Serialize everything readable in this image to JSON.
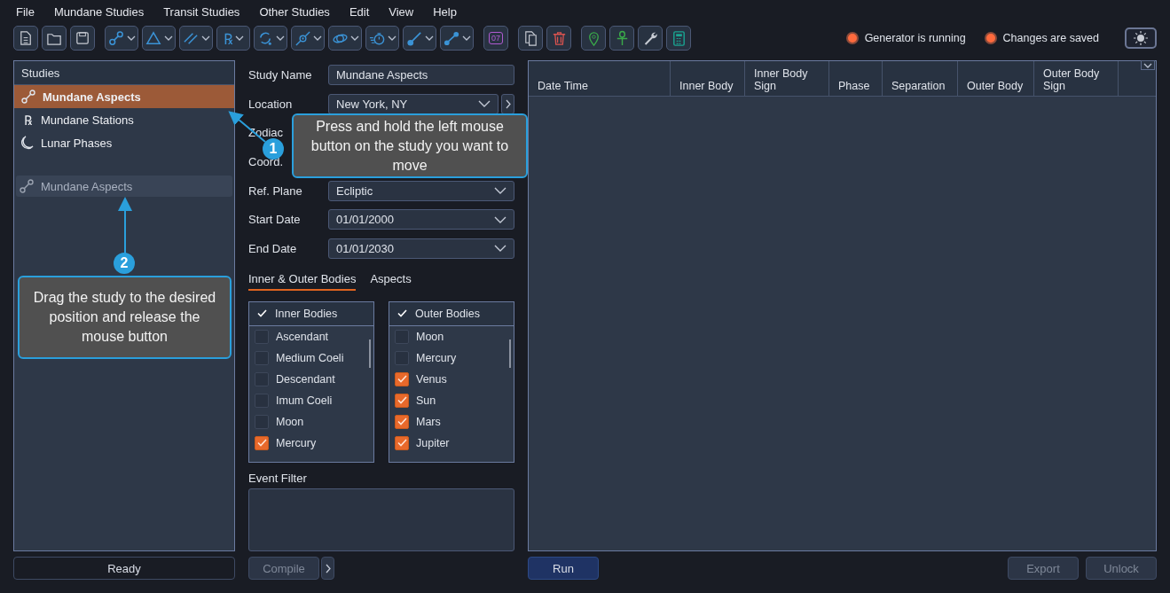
{
  "menu": [
    {
      "label": "File"
    },
    {
      "label": "Mundane Studies"
    },
    {
      "label": "Transit Studies"
    },
    {
      "label": "Other Studies"
    },
    {
      "label": "Edit"
    },
    {
      "label": "View"
    },
    {
      "label": "Help"
    }
  ],
  "toolbar": [
    {
      "tools": [
        {
          "kind": "button"
        },
        {
          "kind": "button"
        },
        {
          "kind": "button"
        }
      ]
    },
    {
      "tools": [
        {
          "kind": "dropdown"
        },
        {
          "kind": "dropdown"
        },
        {
          "kind": "dropdown"
        },
        {
          "kind": "dropdown",
          "glyph": "℞"
        },
        {
          "kind": "dropdown"
        },
        {
          "kind": "dropdown"
        },
        {
          "kind": "dropdown"
        },
        {
          "kind": "dropdown"
        },
        {
          "kind": "dropdown"
        },
        {
          "kind": "dropdown"
        }
      ]
    },
    {
      "tools": [
        {
          "kind": "date",
          "glyph": "07"
        }
      ]
    },
    {
      "tools": [
        {
          "kind": "button"
        },
        {
          "kind": "button"
        }
      ]
    },
    {
      "tools": [
        {
          "kind": "button"
        },
        {
          "kind": "button"
        },
        {
          "kind": "button"
        },
        {
          "kind": "button"
        }
      ]
    }
  ],
  "indicators": [
    {
      "label": "Generator is running",
      "on": true
    },
    {
      "label": "Changes are saved",
      "on": true
    }
  ],
  "studies": {
    "title": "Studies",
    "items": [
      {
        "label": "Mundane Aspects",
        "kind": "aspect",
        "selected": true
      },
      {
        "label": "Mundane Stations",
        "kind": "station",
        "glyph": "℞",
        "selected": false
      },
      {
        "label": "Lunar Phases",
        "kind": "phase",
        "selected": false
      }
    ],
    "drag_ghost": {
      "label": "Mundane Aspects",
      "kind": "aspect"
    }
  },
  "status": "Ready",
  "form": [
    {
      "label": "Study Name",
      "kind": "text",
      "value": "Mundane Aspects"
    },
    {
      "label": "Location",
      "kind": "select_more",
      "value": "New York, NY"
    },
    {
      "label": "Zodiac",
      "kind": "hidden"
    },
    {
      "label": "Coord.",
      "kind": "hidden"
    },
    {
      "label": "Ref. Plane",
      "kind": "select",
      "value": "Ecliptic"
    },
    {
      "label": "Start Date",
      "kind": "select",
      "value": "01/01/2000"
    },
    {
      "label": "End Date",
      "kind": "select",
      "value": "01/01/2030"
    }
  ],
  "tabs": [
    {
      "label": "Inner & Outer Bodies",
      "selected": true
    },
    {
      "label": "Aspects",
      "selected": false
    }
  ],
  "lists": [
    {
      "title": "Inner Bodies",
      "checked": true,
      "items": [
        {
          "label": "Ascendant",
          "checked": false
        },
        {
          "label": "Medium Coeli",
          "checked": false
        },
        {
          "label": "Descendant",
          "checked": false
        },
        {
          "label": "Imum Coeli",
          "checked": false
        },
        {
          "label": "Moon",
          "checked": false
        },
        {
          "label": "Mercury",
          "checked": true
        }
      ]
    },
    {
      "title": "Outer Bodies",
      "checked": true,
      "items": [
        {
          "label": "Moon",
          "checked": false
        },
        {
          "label": "Mercury",
          "checked": false
        },
        {
          "label": "Venus",
          "checked": true
        },
        {
          "label": "Sun",
          "checked": true
        },
        {
          "label": "Mars",
          "checked": true
        },
        {
          "label": "Jupiter",
          "checked": true
        }
      ]
    }
  ],
  "event_filter": {
    "label": "Event Filter"
  },
  "compile": {
    "label": "Compile",
    "disabled": true
  },
  "table": {
    "columns": [
      {
        "label": "Date Time"
      },
      {
        "label": "Inner Body"
      },
      {
        "label": "Inner Body Sign"
      },
      {
        "label": "Phase"
      },
      {
        "label": "Separation"
      },
      {
        "label": "Outer Body"
      },
      {
        "label": "Outer Body Sign"
      }
    ]
  },
  "actions": [
    {
      "label": "Run",
      "disabled": false
    },
    {
      "label": "Export",
      "disabled": true
    },
    {
      "label": "Unlock",
      "disabled": true
    }
  ],
  "callouts": [
    {
      "number": "1",
      "text": "Press and hold the left mouse button on the study you want to move"
    },
    {
      "number": "2",
      "text": "Drag the study to the desired position and release the mouse button"
    }
  ]
}
